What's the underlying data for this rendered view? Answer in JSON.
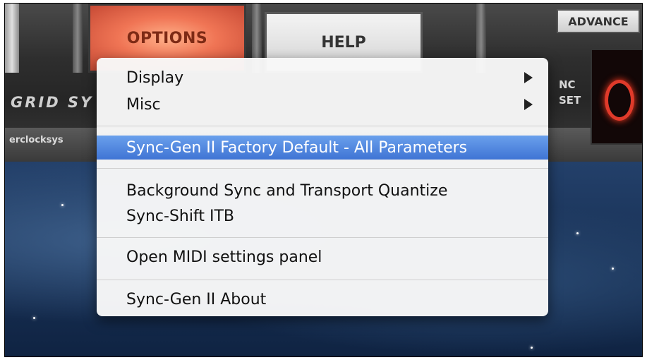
{
  "toolbar": {
    "options_label": "OPTIONS",
    "help_label": "HELP",
    "advance_label": "ADVANCE"
  },
  "brand": {
    "title": "GRID SY",
    "subtitle": "erclocksys"
  },
  "right_panel": {
    "line1": "NC",
    "line2": "SET"
  },
  "menu": {
    "items": [
      {
        "label": "Display",
        "submenu": true
      },
      {
        "label": "Misc",
        "submenu": true
      },
      {
        "label": "Sync-Gen II Factory Default - All Parameters",
        "highlighted": true
      },
      {
        "label": "Background Sync and Transport Quantize"
      },
      {
        "label": "Sync-Shift ITB"
      },
      {
        "label": "Open MIDI settings panel"
      },
      {
        "label": "Sync-Gen II About"
      }
    ]
  },
  "colors": {
    "highlight": "#3f74d4",
    "options_button": "#f07555",
    "display_glow": "#e03a2a"
  }
}
